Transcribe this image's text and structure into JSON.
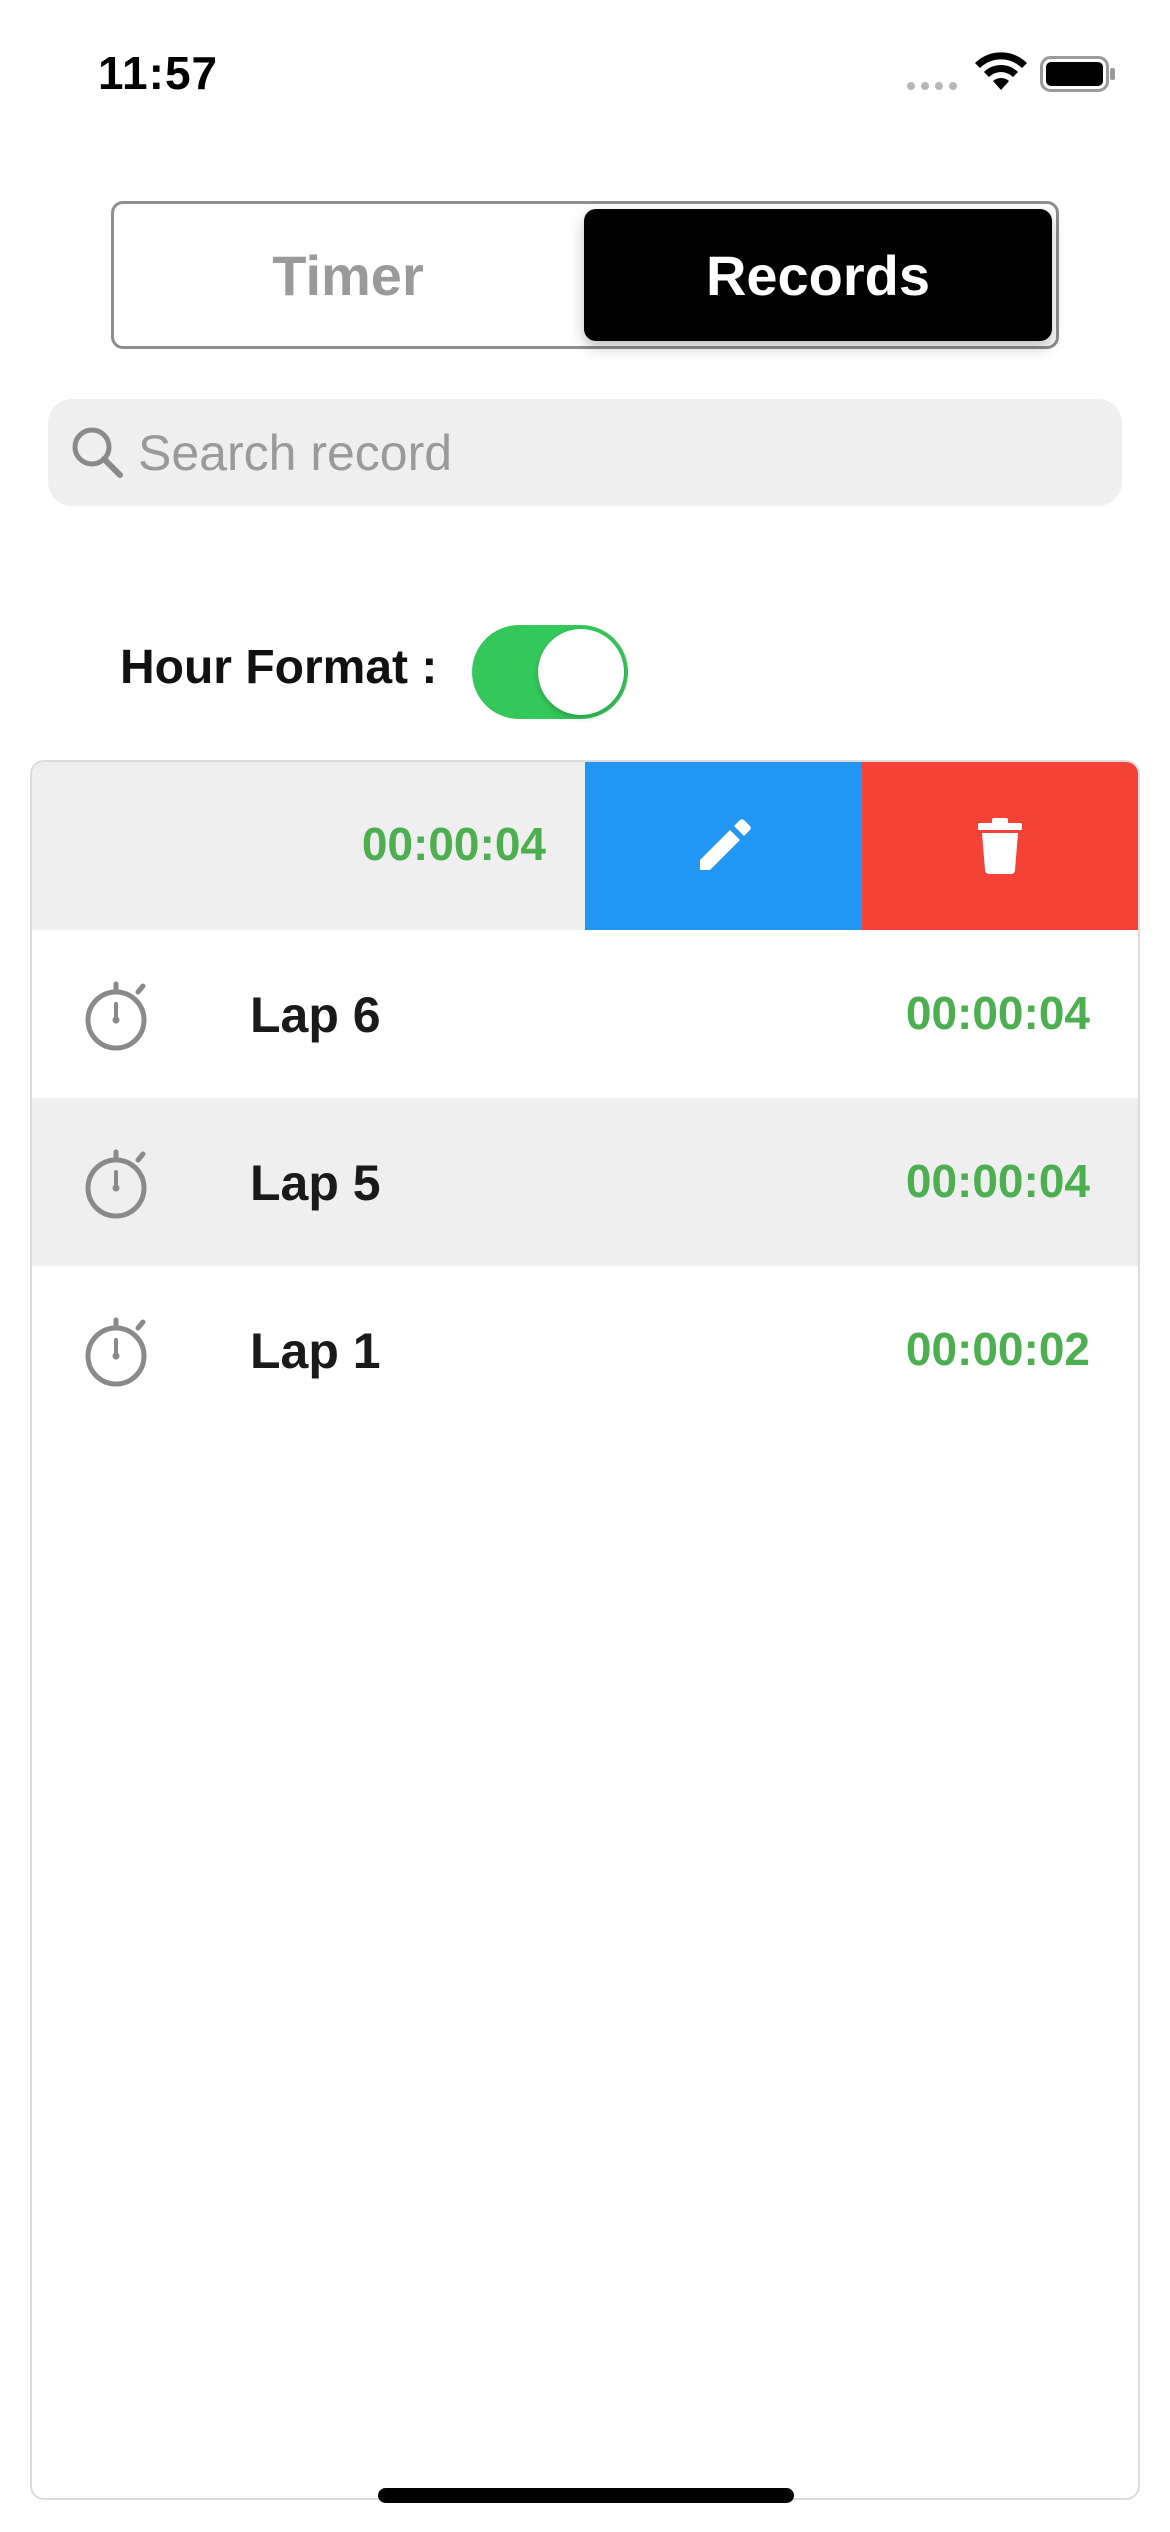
{
  "status_bar": {
    "time": "11:57",
    "icons": [
      "signal-icon",
      "wifi-icon",
      "battery-icon"
    ]
  },
  "segmented_control": {
    "tabs": [
      {
        "label": "Timer",
        "selected": false
      },
      {
        "label": "Records",
        "selected": true
      }
    ]
  },
  "search": {
    "placeholder": "Search record",
    "value": "",
    "icon": "search-icon"
  },
  "settings": {
    "hour_format_label": "Hour Format :",
    "hour_format_enabled": true
  },
  "records": {
    "swiped_row": {
      "time": "00:00:04",
      "actions": [
        {
          "name": "edit",
          "icon": "pencil-icon",
          "color": "#2196f3"
        },
        {
          "name": "delete",
          "icon": "trash-icon",
          "color": "#f44336"
        }
      ]
    },
    "rows": [
      {
        "label": "Lap 6",
        "time": "00:00:04",
        "icon": "stopwatch-icon"
      },
      {
        "label": "Lap 5",
        "time": "00:00:04",
        "icon": "stopwatch-icon"
      },
      {
        "label": "Lap 1",
        "time": "00:00:02",
        "icon": "stopwatch-icon"
      }
    ]
  },
  "colors": {
    "time_text": "#4caf50",
    "toggle_on": "#34c759",
    "segment_selected_bg": "#000000",
    "edit_action": "#2196f3",
    "delete_action": "#f44336"
  }
}
